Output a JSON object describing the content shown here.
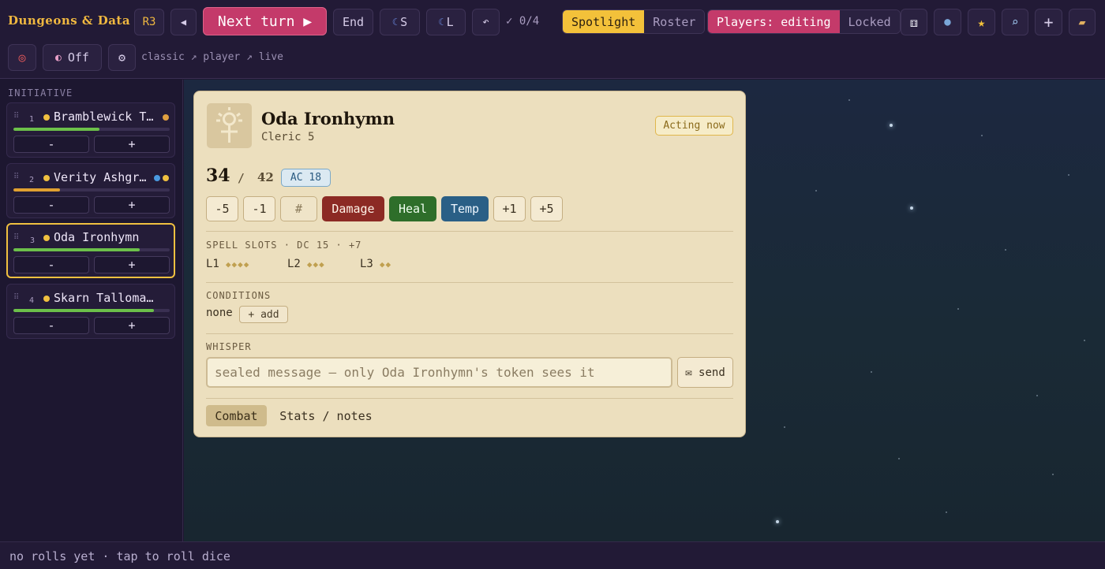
{
  "app": {
    "title": "Dungeons & Data"
  },
  "toolbar": {
    "round": "R3",
    "prev_label": "◀",
    "next_label": "Next turn ▶",
    "end_label": "End",
    "short_rest_label": "S",
    "long_rest_label": "L",
    "undo_label": "↶",
    "checklist": "✓ 0/4",
    "view_mode": {
      "options": [
        "Spotlight",
        "Roster"
      ],
      "selected": "Spotlight"
    },
    "players_mode": {
      "options": [
        "Players: editing",
        "Locked"
      ],
      "selected": "Players: editing"
    },
    "add_label": "+",
    "toggle_label": "Off",
    "breadcrumb": "classic ↗ player ↗ live"
  },
  "sidebar": {
    "title": "INITIATIVE",
    "minus_label": "-",
    "plus_label": "+",
    "combatants": [
      {
        "index": "1",
        "name": "Bramblewick T…",
        "hp_pct": 55,
        "bar_color": "#6cc04a",
        "dot": "#f0c040",
        "extra_dots": [
          "#e0a040"
        ]
      },
      {
        "index": "2",
        "name": "Verity Ashgr…",
        "hp_pct": 30,
        "bar_color": "#e0a030",
        "dot": "#f0c040",
        "extra_dots": [
          "#4a9ae0",
          "#f0c040"
        ]
      },
      {
        "index": "3",
        "name": "Oda Ironhymn",
        "hp_pct": 81,
        "bar_color": "#6cc04a",
        "dot": "#f0c040",
        "extra_dots": [],
        "active": true
      },
      {
        "index": "4",
        "name": "Skarn Talloma…",
        "hp_pct": 90,
        "bar_color": "#6cc04a",
        "dot": "#f0c040",
        "extra_dots": []
      }
    ]
  },
  "panel": {
    "name": "Oda Ironhymn",
    "class_level": "Cleric 5",
    "status_badge": "Acting now",
    "hp_current": "34",
    "hp_sep": "/",
    "hp_max": "42",
    "ac": "AC 18",
    "hp_buttons": {
      "minus5": "-5",
      "minus1": "-1",
      "amount": "#",
      "damage": "Damage",
      "heal": "Heal",
      "temp": "Temp",
      "plus1": "+1",
      "plus5": "+5"
    },
    "spell_slots_header": "SPELL SLOTS · DC 15 · +7",
    "spell_slots": [
      {
        "level": "L1",
        "pips": "◆◆◆◆"
      },
      {
        "level": "L2",
        "pips": "◆◆◆"
      },
      {
        "level": "L3",
        "pips": "◆◆"
      }
    ],
    "conditions_header": "CONDITIONS",
    "conditions_value": "none",
    "conditions_add": "+ add",
    "whisper_header": "WHISPER",
    "whisper_placeholder": "sealed message — only Oda Ironhymn's token sees it",
    "whisper_send": "✉ send",
    "tabs": [
      "Combat",
      "Stats / notes"
    ],
    "active_tab": "Combat"
  },
  "status": {
    "text": "no rolls yet · tap to roll dice"
  },
  "colors": {
    "accent_pink": "#c43a6a",
    "accent_yellow": "#f3c13a",
    "parchment": "#ecdfbe"
  }
}
